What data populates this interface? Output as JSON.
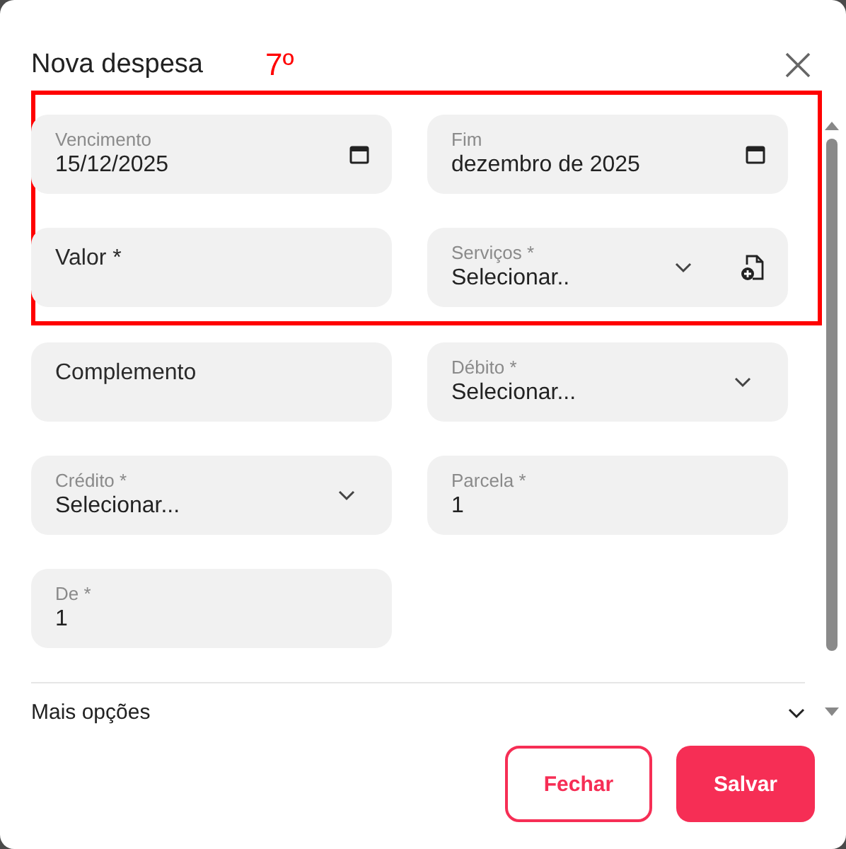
{
  "dialog": {
    "title": "Nova despesa"
  },
  "highlight_box": {
    "label": "7º",
    "fields": [
      {
        "kind": "date",
        "label": "Vencimento",
        "value": "15/12/2025"
      },
      {
        "kind": "date",
        "label": "Fim",
        "value": "dezembro de 2025"
      },
      {
        "kind": "text",
        "placeholder": "Valor *"
      },
      {
        "kind": "select",
        "label": "Serviços *",
        "value": "Selecionar..",
        "add_button": true
      }
    ]
  },
  "fields": [
    {
      "kind": "text",
      "placeholder": "Complemento"
    },
    {
      "kind": "select",
      "label": "Débito *",
      "value": "Selecionar..."
    },
    {
      "kind": "select",
      "label": "Crédito *",
      "value": "Selecionar..."
    },
    {
      "kind": "text",
      "label": "Parcela *",
      "value": "1"
    },
    {
      "kind": "text",
      "label": "De *",
      "value": "1"
    }
  ],
  "more_options": {
    "label": "Mais opções"
  },
  "buttons": [
    {
      "label": "Fechar",
      "kind": "secondary"
    },
    {
      "label": "Salvar",
      "kind": "primary"
    }
  ]
}
